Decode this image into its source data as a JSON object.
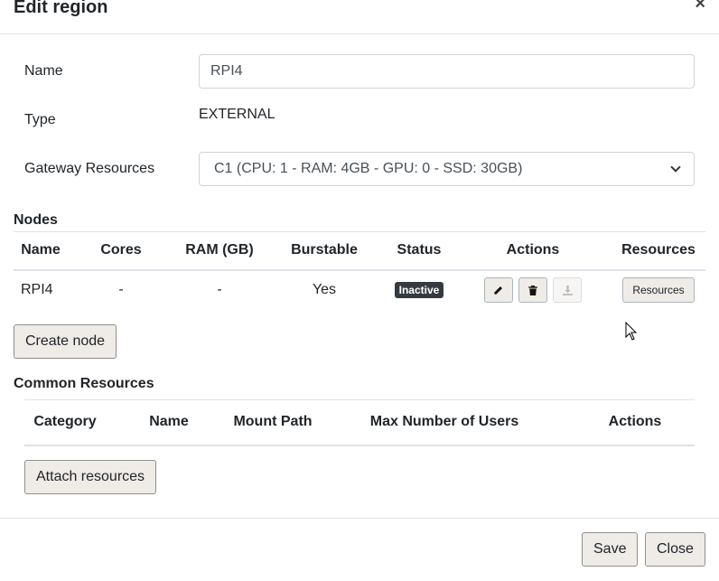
{
  "modal": {
    "title": "Edit region",
    "close_glyph": "×"
  },
  "form": {
    "name_label": "Name",
    "name_value": "RPI4",
    "type_label": "Type",
    "type_value": "EXTERNAL",
    "gateway_label": "Gateway Resources",
    "gateway_selected": "C1 (CPU: 1 - RAM: 4GB - GPU: 0 - SSD: 30GB)"
  },
  "nodes": {
    "title": "Nodes",
    "columns": [
      "Name",
      "Cores",
      "RAM (GB)",
      "Burstable",
      "Status",
      "Actions",
      "Resources"
    ],
    "rows": [
      {
        "name": "RPI4",
        "cores": "-",
        "ram": "-",
        "burstable": "Yes",
        "status": "Inactive",
        "resources_button": "Resources"
      }
    ],
    "icons": {
      "edit": "pencil-icon",
      "delete": "trash-icon",
      "download": "download-icon"
    },
    "create_button": "Create node"
  },
  "common_resources": {
    "title": "Common Resources",
    "columns": [
      "Category",
      "Name",
      "Mount Path",
      "Max Number of Users",
      "Actions"
    ],
    "attach_button": "Attach resources"
  },
  "footer": {
    "save_button": "Save",
    "close_button": "Close"
  },
  "colors": {
    "badge_bg": "#343a40",
    "button_bg": "#efebe7",
    "border": "#dee2e6"
  }
}
